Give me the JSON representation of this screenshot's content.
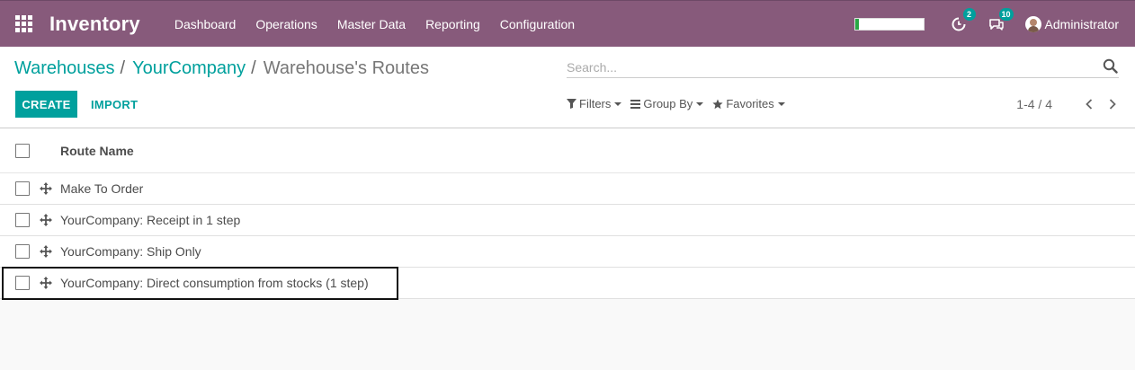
{
  "navbar": {
    "app_name": "Inventory",
    "menu": [
      "Dashboard",
      "Operations",
      "Master Data",
      "Reporting",
      "Configuration"
    ],
    "activity_badge": "2",
    "messages_badge": "10",
    "user_name": "Administrator",
    "progress_fraction": 0.06,
    "accent_color": "#875a7b"
  },
  "breadcrumb": {
    "items": [
      "Warehouses",
      "YourCompany"
    ],
    "separator": "/",
    "current": "Warehouse's Routes"
  },
  "search": {
    "placeholder": "Search..."
  },
  "buttons": {
    "create": "CREATE",
    "import": "IMPORT"
  },
  "filters": {
    "filters": "Filters",
    "group_by": "Group By",
    "favorites": "Favorites"
  },
  "pager": {
    "value": "1-4 / 4"
  },
  "list": {
    "column_header": "Route Name",
    "rows": [
      "Make To Order",
      "YourCompany: Receipt in 1 step",
      "YourCompany: Ship Only",
      "YourCompany: Direct consumption from stocks (1 step)"
    ]
  },
  "colors": {
    "primary": "#00a09d",
    "navbar": "#875a7b"
  }
}
